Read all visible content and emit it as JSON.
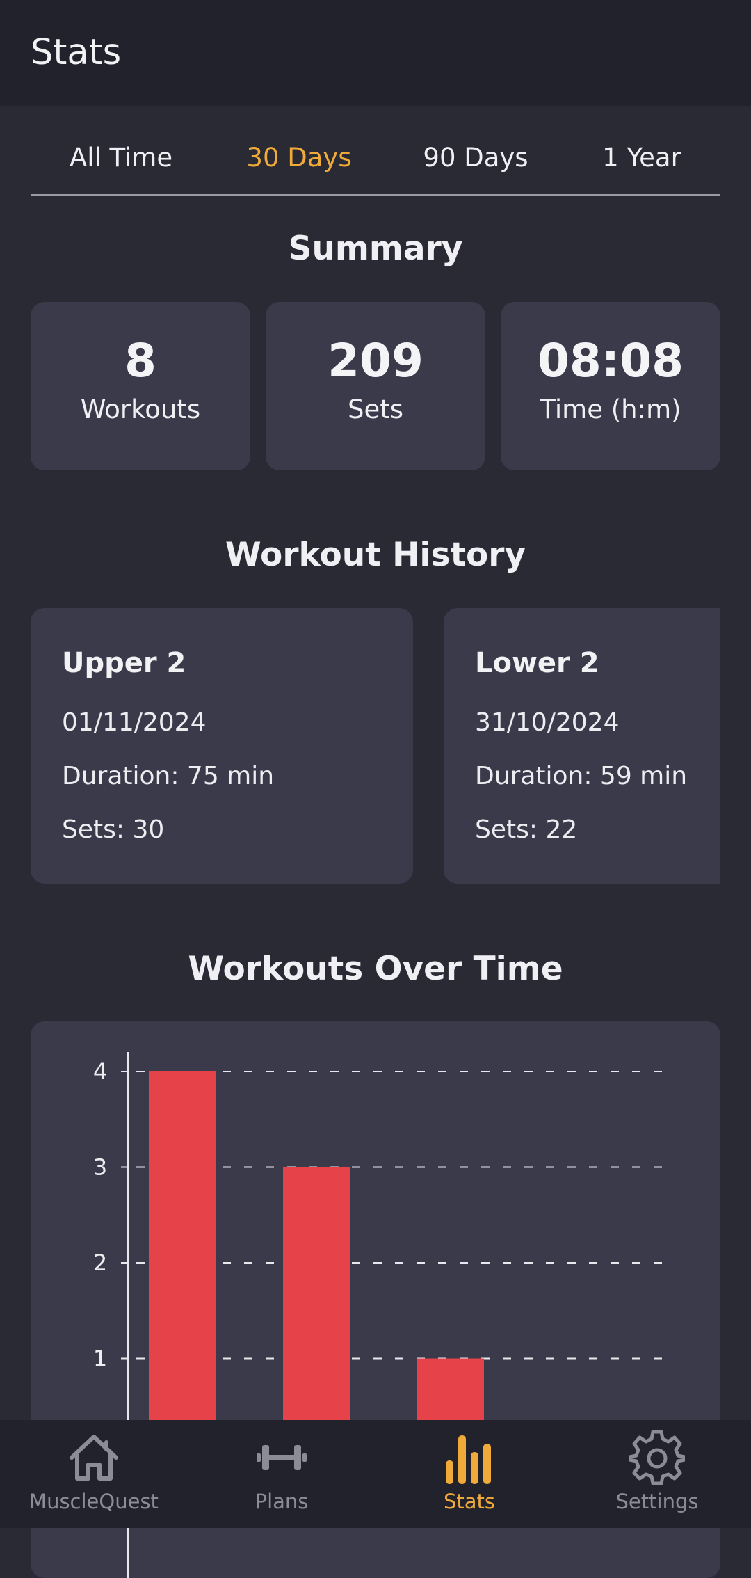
{
  "header": {
    "title": "Stats"
  },
  "tabs": [
    "All Time",
    "30 Days",
    "90 Days",
    "1 Year"
  ],
  "active_tab": "30 Days",
  "summary": {
    "title": "Summary",
    "cards": [
      {
        "value": "8",
        "label": "Workouts"
      },
      {
        "value": "209",
        "label": "Sets"
      },
      {
        "value": "08:08",
        "label": "Time (h:m)"
      }
    ]
  },
  "history": {
    "title": "Workout History",
    "items": [
      {
        "name": "Upper 2",
        "date": "01/11/2024",
        "duration": "Duration: 75 min",
        "sets": "Sets: 30"
      },
      {
        "name": "Lower 2",
        "date": "31/10/2024",
        "duration": "Duration: 59 min",
        "sets": "Sets: 22"
      }
    ]
  },
  "chart_section": {
    "title": "Workouts Over Time"
  },
  "chart_data": {
    "type": "bar",
    "values": [
      4,
      3,
      1
    ],
    "yticks": [
      1,
      2,
      3,
      4
    ],
    "ylim": [
      0,
      4
    ],
    "grid": true,
    "bar_color": "#e5424a"
  },
  "nav": {
    "items": [
      {
        "label": "MuscleQuest",
        "icon": "home-icon"
      },
      {
        "label": "Plans",
        "icon": "dumbbell-icon"
      },
      {
        "label": "Stats",
        "icon": "bar-chart-icon"
      },
      {
        "label": "Settings",
        "icon": "gear-icon"
      }
    ],
    "active": "Stats"
  },
  "colors": {
    "accent": "#f0aa3a",
    "background": "#2a2a35",
    "card": "#3a3a4a",
    "header": "#22222d",
    "inactive_nav": "#8c8c96"
  }
}
